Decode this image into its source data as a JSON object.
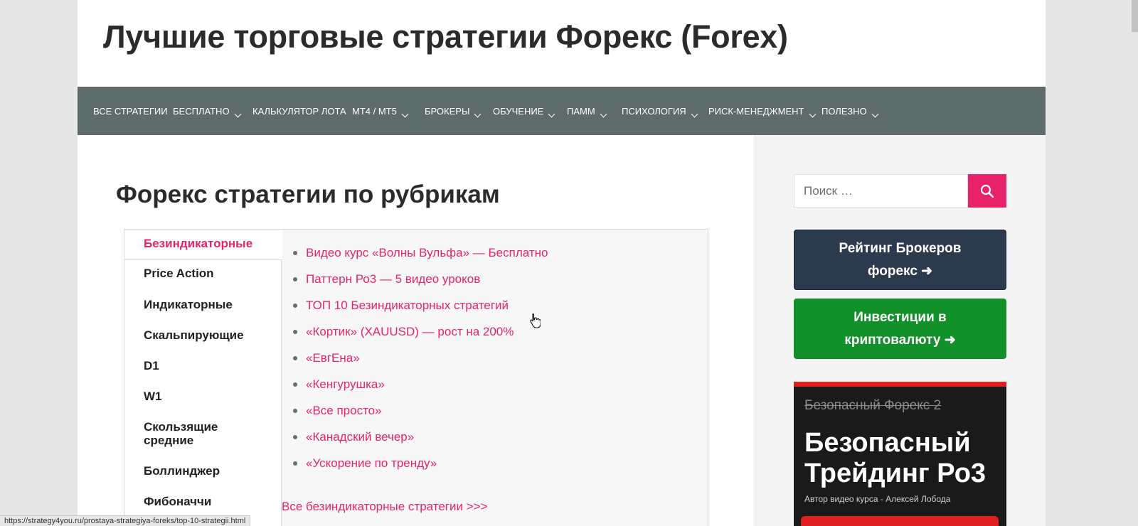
{
  "site": {
    "title": "Лучшие торговые стратегии Форекс (Forex)"
  },
  "nav": [
    {
      "label": "Все стратегии",
      "has_dropdown": false
    },
    {
      "label": "Бесплатно",
      "has_dropdown": true
    },
    {
      "label": "Калькулятор лота",
      "has_dropdown": false
    },
    {
      "label": "MT4 / MT5",
      "has_dropdown": true
    },
    {
      "label": "Брокеры",
      "has_dropdown": true
    },
    {
      "label": "Обучение",
      "has_dropdown": true
    },
    {
      "label": "ПАММ",
      "has_dropdown": true
    },
    {
      "label": "Психология",
      "has_dropdown": true
    },
    {
      "label": "Риск-менеджмент",
      "has_dropdown": true
    },
    {
      "label": "Полезно",
      "has_dropdown": true
    }
  ],
  "main": {
    "section_title": "Форекс стратегии по рубрикам",
    "tabs": [
      {
        "label": "Безиндикаторные",
        "active": true
      },
      {
        "label": "Price Action"
      },
      {
        "label": "Индикаторные"
      },
      {
        "label": "Скальпирующие"
      },
      {
        "label": "D1"
      },
      {
        "label": "W1"
      },
      {
        "label": "Скользящие средние"
      },
      {
        "label": "Боллинджер"
      },
      {
        "label": "Фибоначчи"
      }
    ],
    "links": [
      "Видео курс «Волны Вульфа» — Бесплатно",
      "Паттерн Ро3 — 5 видео уроков",
      "ТОП 10 Безиндикаторных стратегий",
      "«Кортик» (XAUUSD) — рост на 200%",
      "«ЕвгЕна»",
      "«Кенгурушка»",
      "«Все просто»",
      "«Канадский вечер»",
      "«Ускорение по тренду»"
    ],
    "all_link": "Все безиндикаторные стратегии >>>"
  },
  "sidebar": {
    "search_placeholder": "Поиск …",
    "brokers_button": "Рейтинг Брокеров форекс ➜",
    "crypto_button": "Инвестиции в криптовалюту ➜",
    "banner": {
      "old_title": "Безопасный Форекс 2",
      "title_line1": "Безопасный",
      "title_line2": "Трейдинг Ро3",
      "author": "Автор видео курса - Алексей Лобода"
    }
  },
  "status_bar": {
    "url": "https://strategy4you.ru/prostaya-strategiya-foreks/top-10-strategii.html"
  },
  "colors": {
    "accent": "#e8236b",
    "nav_bg": "#5d6b6b",
    "brokers_bg": "#2c3a4e",
    "crypto_bg": "#12902a",
    "banner_bg": "#1a1a1a",
    "banner_red": "#e02020"
  },
  "icons": {
    "search": "magnifier-icon",
    "dropdown": "chevron-down-icon",
    "cursor": "hand-pointer-icon"
  }
}
